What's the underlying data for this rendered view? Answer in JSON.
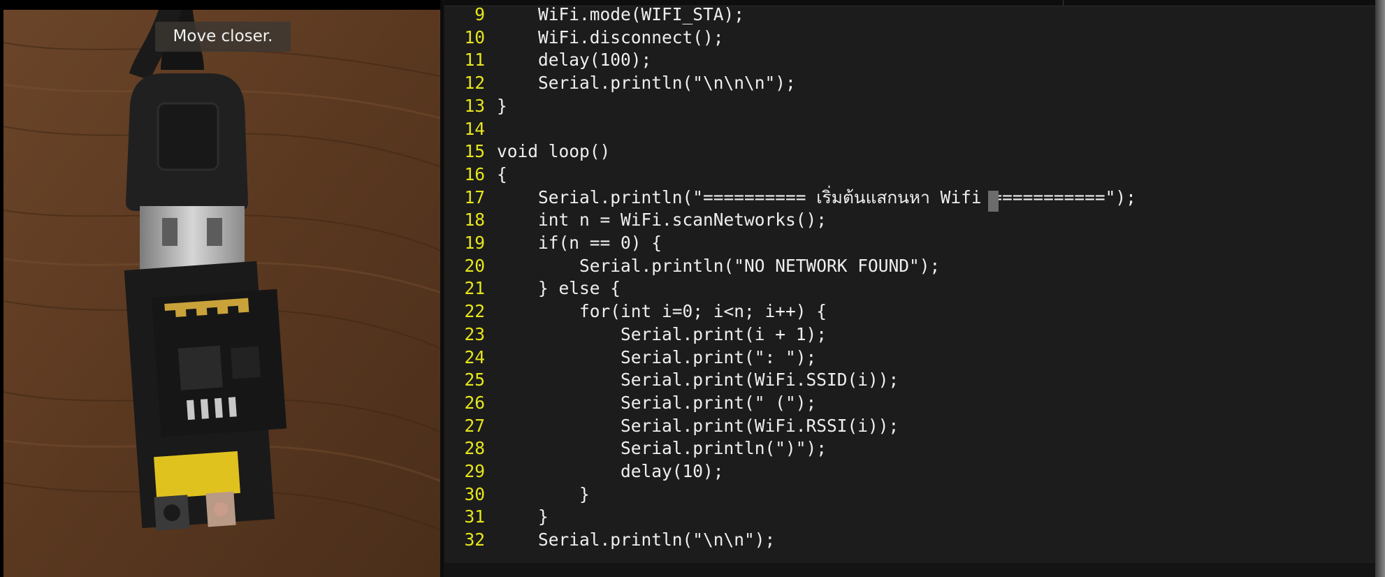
{
  "camera": {
    "hint": "Move closer."
  },
  "editor": {
    "lines": [
      {
        "num": "9",
        "code": "    WiFi.mode(WIFI_STA);"
      },
      {
        "num": "10",
        "code": "    WiFi.disconnect();"
      },
      {
        "num": "11",
        "code": "    delay(100);"
      },
      {
        "num": "12",
        "code": "    Serial.println(\"\\n\\n\\n\");"
      },
      {
        "num": "13",
        "code": "}"
      },
      {
        "num": "14",
        "code": ""
      },
      {
        "num": "15",
        "code": "void loop()"
      },
      {
        "num": "16",
        "code": "{"
      },
      {
        "num": "17",
        "code": "    Serial.println(\"========== เริ่มต้นแสกนหา Wifi ===========\");"
      },
      {
        "num": "18",
        "code": "    int n = WiFi.scanNetworks();"
      },
      {
        "num": "19",
        "code": "    if(n == 0) {"
      },
      {
        "num": "20",
        "code": "        Serial.println(\"NO NETWORK FOUND\");"
      },
      {
        "num": "21",
        "code": "    } else {"
      },
      {
        "num": "22",
        "code": "        for(int i=0; i<n; i++) {"
      },
      {
        "num": "23",
        "code": "            Serial.print(i + 1);"
      },
      {
        "num": "24",
        "code": "            Serial.print(\": \");"
      },
      {
        "num": "25",
        "code": "            Serial.print(WiFi.SSID(i));"
      },
      {
        "num": "26",
        "code": "            Serial.print(\" (\");"
      },
      {
        "num": "27",
        "code": "            Serial.print(WiFi.RSSI(i));"
      },
      {
        "num": "28",
        "code": "            Serial.println(\")\");"
      },
      {
        "num": "29",
        "code": "            delay(10);"
      },
      {
        "num": "30",
        "code": "        }"
      },
      {
        "num": "31",
        "code": "    }"
      },
      {
        "num": "32",
        "code": "    Serial.println(\"\\n\\n\");"
      }
    ],
    "colors": {
      "background": "#1c1c1c",
      "line_number": "#e6e61c",
      "text": "#efefef",
      "cursor": "#6c6c6c"
    }
  }
}
